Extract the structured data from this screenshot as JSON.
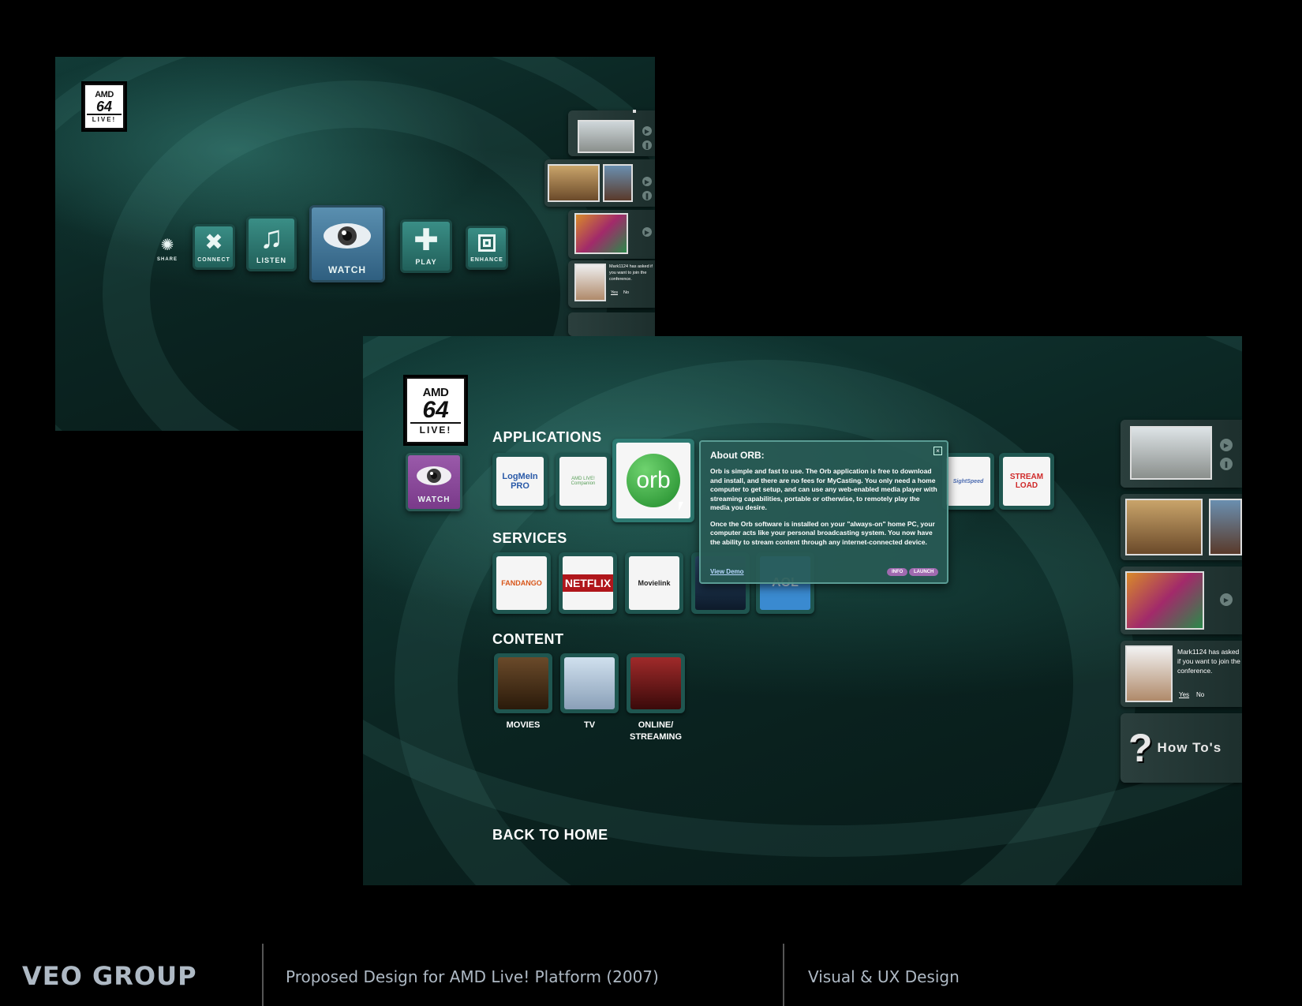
{
  "screen1": {
    "logo": {
      "line1": "AMD",
      "line2": "64",
      "line3": "LIVE!"
    },
    "nav": [
      {
        "label": "SHARE",
        "icon": "sun-icon"
      },
      {
        "label": "CONNECT",
        "icon": "cross-icon"
      },
      {
        "label": "LISTEN",
        "icon": "music-note-icon"
      },
      {
        "label": "WATCH",
        "icon": "eye-icon"
      },
      {
        "label": "PLAY",
        "icon": "puzzle-icon"
      },
      {
        "label": "ENHANCE",
        "icon": "square-icon"
      }
    ],
    "notification": {
      "message": "Mark1124 has asked if you want to join the conference.",
      "yes": "Yes",
      "no": "No"
    }
  },
  "screen2": {
    "logo": {
      "line1": "AMD",
      "line2": "64",
      "line3": "LIVE!"
    },
    "watch_label": "WATCH",
    "applications": {
      "title": "APPLICATIONS",
      "tiles": [
        "LogMeIn PRO",
        "AMD LIVE! Companion",
        "orb",
        "SightSpeed",
        "STREAM LOAD"
      ]
    },
    "services": {
      "title": "SERVICES",
      "tiles": [
        "FANDANGO",
        "NETFLIX",
        "Movielink",
        "",
        "AOL"
      ]
    },
    "content": {
      "title": "CONTENT",
      "tiles": [
        {
          "caption": "MOVIES"
        },
        {
          "caption": "TV"
        },
        {
          "caption": "ONLINE/\nSTREAMING"
        }
      ]
    },
    "popup": {
      "title": "About ORB:",
      "p1": "Orb is simple and fast to use. The Orb application is free to download and install, and there are no fees for MyCasting. You only need a home computer to get setup, and can use any web-enabled media player with streaming capabilities, portable or otherwise, to remotely play the media you desire.",
      "p2": "Once the Orb software is installed on your \"always-on\" home PC, your computer acts like your personal broadcasting system. You now have the ability to stream content through any internet-connected device.",
      "view_demo": "View Demo",
      "info": "INFO",
      "launch": "LAUNCH"
    },
    "notification": {
      "message": "Mark1124 has asked if you want to join the conference.",
      "yes": "Yes",
      "no": "No"
    },
    "howto": "How To's",
    "back": "BACK TO HOME"
  },
  "footer": {
    "company": "VEO GROUP",
    "project": "Proposed Design for AMD Live! Platform (2007)",
    "discipline": "Visual & UX Design"
  },
  "colors": {
    "accent": "#2f7d75",
    "watch_purple": "#8a4f9a",
    "footer_text": "#aeb9c4"
  }
}
